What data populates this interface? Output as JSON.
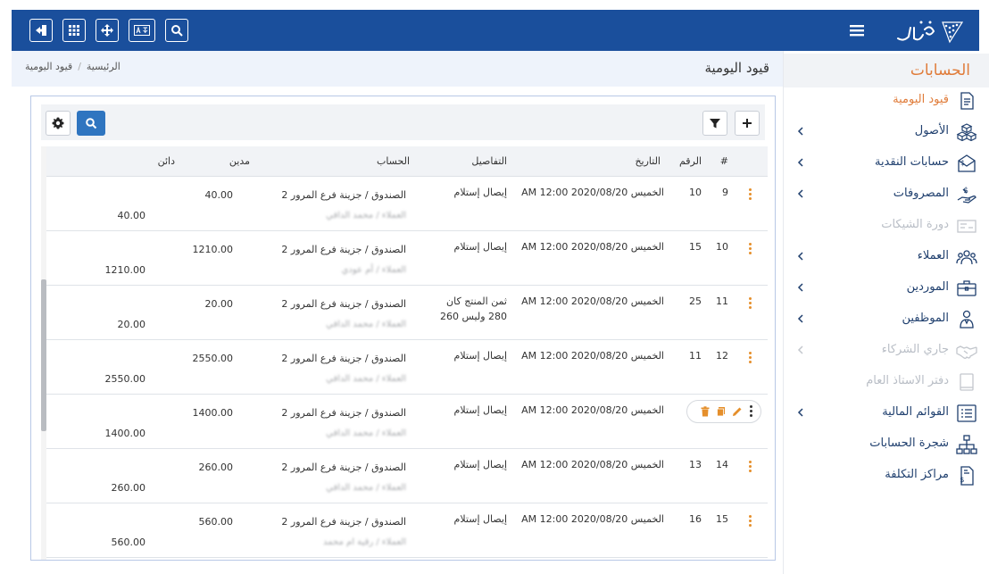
{
  "colors": {
    "topbar": "#1a4f9c",
    "accent": "#e07c3a",
    "nav_text": "#1f3f6e",
    "primary_button": "#2f75c0",
    "row_action": "#e58f2b"
  },
  "topbar": {
    "icons": [
      "logout-icon",
      "grid-icon",
      "move-icon",
      "translate-icon",
      "search-icon"
    ],
    "menu_icon": "hamburger-icon",
    "logo": "arzaq-logo"
  },
  "sidebar": {
    "title": "الحسابات",
    "items": [
      {
        "label": "قيود اليومية",
        "icon": "journal-icon",
        "state": "active",
        "has_submenu": false
      },
      {
        "label": "الأصول",
        "icon": "boxes-icon",
        "state": "normal",
        "has_submenu": true
      },
      {
        "label": "حسابات النقدية",
        "icon": "cash-envelope-icon",
        "state": "normal",
        "has_submenu": true
      },
      {
        "label": "المصروفات",
        "icon": "expense-hand-icon",
        "state": "normal",
        "has_submenu": true
      },
      {
        "label": "دورة الشيكات",
        "icon": "cheque-icon",
        "state": "disabled",
        "has_submenu": false
      },
      {
        "label": "العملاء",
        "icon": "customers-icon",
        "state": "normal",
        "has_submenu": true
      },
      {
        "label": "الموردين",
        "icon": "suppliers-briefcase-icon",
        "state": "normal",
        "has_submenu": true
      },
      {
        "label": "الموظفين",
        "icon": "employees-icon",
        "state": "normal",
        "has_submenu": true
      },
      {
        "label": "جاري الشركاء",
        "icon": "handshake-icon",
        "state": "disabled",
        "has_submenu": true
      },
      {
        "label": "دفتر الاستاذ العام",
        "icon": "ledger-book-icon",
        "state": "disabled",
        "has_submenu": false
      },
      {
        "label": "القوائم المالية",
        "icon": "financial-list-icon",
        "state": "normal",
        "has_submenu": true
      },
      {
        "label": "شجرة الحسابات",
        "icon": "account-tree-icon",
        "state": "normal",
        "has_submenu": false
      },
      {
        "label": "مراكز التكلفة",
        "icon": "cost-center-icon",
        "state": "normal",
        "has_submenu": false
      }
    ]
  },
  "header": {
    "page_title": "قيود اليومية",
    "breadcrumb": {
      "home": "الرئيسية",
      "separator": "/",
      "current": "قيود اليومية"
    }
  },
  "toolbar": {
    "left_icons": [
      "settings-gear-icon",
      "search-icon"
    ],
    "right_icons": [
      "filter-icon",
      "add-icon"
    ]
  },
  "table": {
    "columns": {
      "hash": "#",
      "number": "الرقم",
      "date": "التاريخ",
      "details": "التفاصيل",
      "account": "الحساب",
      "debit": "مدين",
      "credit": "دائن"
    },
    "rows": [
      {
        "idx": "9",
        "number": "10",
        "date": "الخميس 2020/08/20 AM 12:00",
        "details": [
          "إيصال إستلام"
        ],
        "account": "الصندوق / جزينة فرع المرور 2",
        "sub_account": "العملاء / محمد الدافي",
        "debit": "40.00",
        "credit": "40.00"
      },
      {
        "idx": "10",
        "number": "15",
        "date": "الخميس 2020/08/20 AM 12:00",
        "details": [
          "إيصال إستلام"
        ],
        "account": "الصندوق / جزينة فرع المرور 2",
        "sub_account": "العملاء / أم عودي",
        "debit": "1210.00",
        "credit": "1210.00"
      },
      {
        "idx": "11",
        "number": "25",
        "date": "الخميس 2020/08/20 AM 12:00",
        "details": [
          "ثمن المنتج كان",
          "280 وليس 260"
        ],
        "account": "الصندوق / جزينة فرع المرور 2",
        "sub_account": "العملاء / محمد الدافي",
        "debit": "20.00",
        "credit": "20.00"
      },
      {
        "idx": "12",
        "number": "11",
        "date": "الخميس 2020/08/20 AM 12:00",
        "details": [
          "إيصال إستلام"
        ],
        "account": "الصندوق / جزينة فرع المرور 2",
        "sub_account": "العملاء / محمد الدافي",
        "debit": "2550.00",
        "credit": "2550.00"
      },
      {
        "idx": "",
        "number": "",
        "date": "الخميس 2020/08/20 AM 12:00",
        "details": [
          "إيصال إستلام"
        ],
        "account": "الصندوق / جزينة فرع المرور 2",
        "sub_account": "العملاء / محمد الدافي",
        "debit": "1400.00",
        "credit": "1400.00",
        "actions_open": true
      },
      {
        "idx": "14",
        "number": "13",
        "date": "الخميس 2020/08/20 AM 12:00",
        "details": [
          "إيصال إستلام"
        ],
        "account": "الصندوق / جزينة فرع المرور 2",
        "sub_account": "العملاء / محمد الدافي",
        "debit": "260.00",
        "credit": "260.00"
      },
      {
        "idx": "15",
        "number": "16",
        "date": "الخميس 2020/08/20 AM 12:00",
        "details": [
          "إيصال إستلام"
        ],
        "account": "الصندوق / جزينة فرع المرور 2",
        "sub_account": "العملاء / رقية ام محمد",
        "debit": "560.00",
        "credit": "560.00"
      }
    ],
    "row_actions": [
      "delete-icon",
      "copy-icon",
      "edit-icon",
      "more-icon"
    ]
  }
}
